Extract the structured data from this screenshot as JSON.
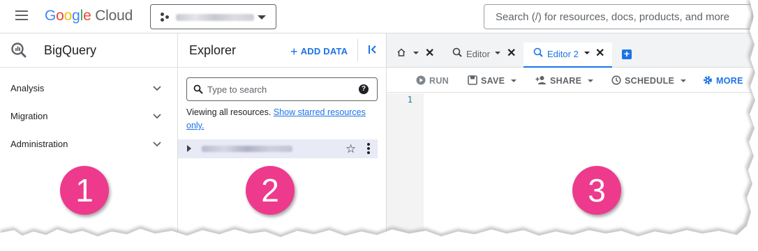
{
  "header": {
    "logo_google": "Google",
    "logo_cloud": "Cloud",
    "search_placeholder": "Search (/) for resources, docs, products, and more"
  },
  "nav": {
    "product_title": "BigQuery",
    "items": [
      {
        "label": "Analysis"
      },
      {
        "label": "Migration"
      },
      {
        "label": "Administration"
      }
    ]
  },
  "explorer": {
    "title": "Explorer",
    "add_data_label": "ADD DATA",
    "search_placeholder": "Type to search",
    "viewing_text": "Viewing all resources.",
    "starred_link": "Show starred resources only."
  },
  "editor": {
    "tabs": [
      {
        "label": ""
      },
      {
        "label": "Editor"
      },
      {
        "label": "Editor 2",
        "active": true
      }
    ],
    "toolbar": {
      "run": "RUN",
      "save": "SAVE",
      "share": "SHARE",
      "schedule": "SCHEDULE",
      "more": "MORE"
    },
    "line_number": "1"
  },
  "callouts": [
    "1",
    "2",
    "3"
  ],
  "colors": {
    "accent": "#1a73e8",
    "callout": "#ee3a8c",
    "selected_row": "#e8eaf6"
  }
}
